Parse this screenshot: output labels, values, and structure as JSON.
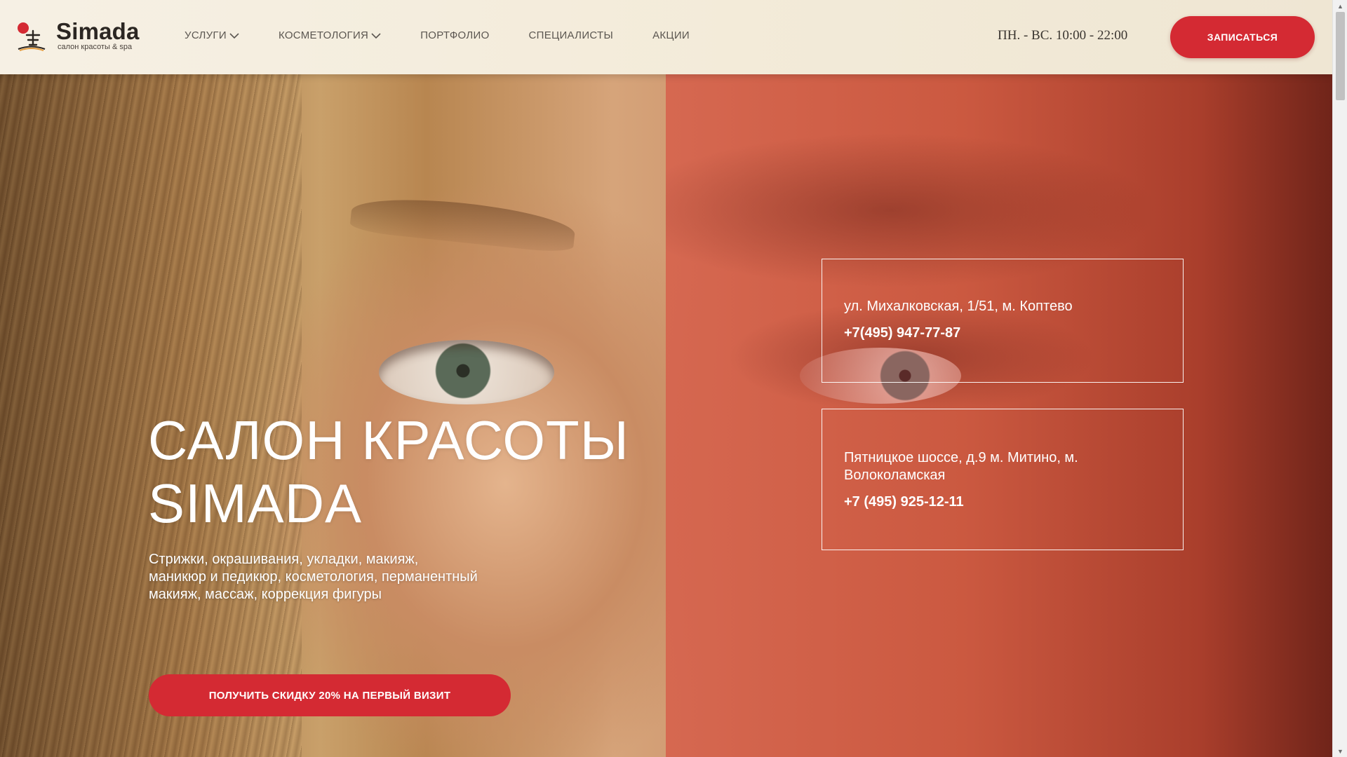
{
  "header": {
    "logo": {
      "name": "Simada",
      "subtitle": "салон красоты & spa",
      "icon": "simada-logo-icon"
    },
    "nav": [
      {
        "label": "УСЛУГИ",
        "has_dropdown": true
      },
      {
        "label": "КОСМЕТОЛОГИЯ",
        "has_dropdown": true
      },
      {
        "label": "ПОРТФОЛИО",
        "has_dropdown": false
      },
      {
        "label": "СПЕЦИАЛИСТЫ",
        "has_dropdown": false
      },
      {
        "label": "АКЦИИ",
        "has_dropdown": false
      }
    ],
    "hours": "ПН. - ВС. 10:00 - 22:00",
    "cta_label": "ЗАПИСАТЬСЯ"
  },
  "hero": {
    "title_line1": "САЛОН КРАСОТЫ",
    "title_line2": "SIMADA",
    "description": "Стрижки, окрашивания, укладки, макияж, маникюр и педикюр, косметология, перманентный макияж, массаж, коррекция фигуры",
    "cta_label": "ПОЛУЧИТЬ СКИДКУ 20% НА ПЕРВЫЙ ВИЗИТ"
  },
  "locations": [
    {
      "address": "ул. Михалковская, 1/51, м. Коптево",
      "phone": "+7(495) 947-77-87"
    },
    {
      "address": "Пятницкое шоссе, д.9 м. Митино, м. Волоколамская",
      "phone": "+7 (495) 925-12-11"
    }
  ],
  "colors": {
    "accent": "#d42a33",
    "header_bg": "#f4eddd",
    "nav_text": "#5b5650",
    "overlay": "#cc563e"
  },
  "scrollbar": {
    "up_icon": "scroll-up-arrow-icon",
    "down_icon": "scroll-down-arrow-icon"
  }
}
